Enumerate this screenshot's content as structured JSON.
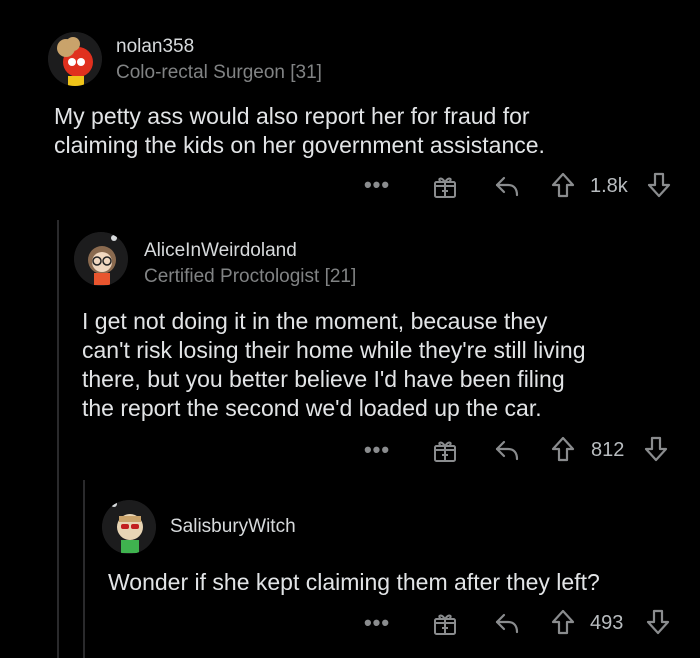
{
  "comments": [
    {
      "username": "nolan358",
      "flair": "Colo-rectal Surgeon [31]",
      "body_lines": [
        "My petty ass would also report her for fraud for",
        "claiming the kids on her government assistance."
      ],
      "score": "1.8k",
      "avatar_icon": "avatar-red-character-icon"
    },
    {
      "username": "AliceInWeirdoland",
      "flair": "Certified Proctologist [21]",
      "body_lines": [
        "I get not doing it in the moment, because they",
        "can't risk losing their home while they're still living",
        "there, but you better believe I'd have been filing",
        "the report the second we'd loaded up the car."
      ],
      "score": "812",
      "avatar_icon": "avatar-glasses-character-icon"
    },
    {
      "username": "SalisburyWitch",
      "flair": "",
      "body_lines": [
        "Wonder if she kept claiming them after they left?"
      ],
      "score": "493",
      "avatar_icon": "avatar-sunglasses-character-icon"
    }
  ],
  "actions": {
    "more_label": "•••",
    "more_icon": "more-options-icon",
    "award_icon": "award-gift-icon",
    "reply_icon": "reply-arrow-icon",
    "upvote_icon": "upvote-arrow-icon",
    "downvote_icon": "downvote-arrow-icon"
  },
  "colors": {
    "background": "#000000",
    "text": "#e2e4e6",
    "muted": "#818384",
    "thread": "#2a2a2c"
  }
}
